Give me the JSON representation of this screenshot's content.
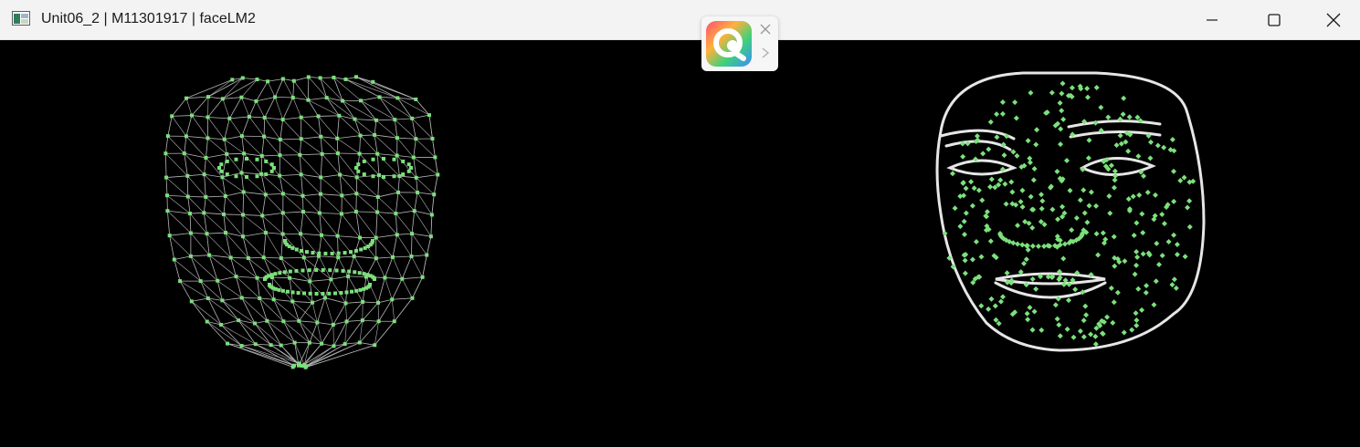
{
  "window": {
    "title": "Unit06_2 | M11301917 | faceLM2",
    "controls": [
      "minimize-icon",
      "maximize-icon",
      "close-icon"
    ]
  },
  "popup": {
    "icons": [
      "assistant-logo-icon",
      "close-icon",
      "chevron-right-icon"
    ]
  },
  "canvas": {
    "background": "#000000",
    "landmark_color": "#7CE07C",
    "mesh_color": "#b5b5b5",
    "contour_color": "#e6e6e6",
    "panels": [
      "face-mesh-tesselation",
      "face-contours-landmarks"
    ]
  }
}
